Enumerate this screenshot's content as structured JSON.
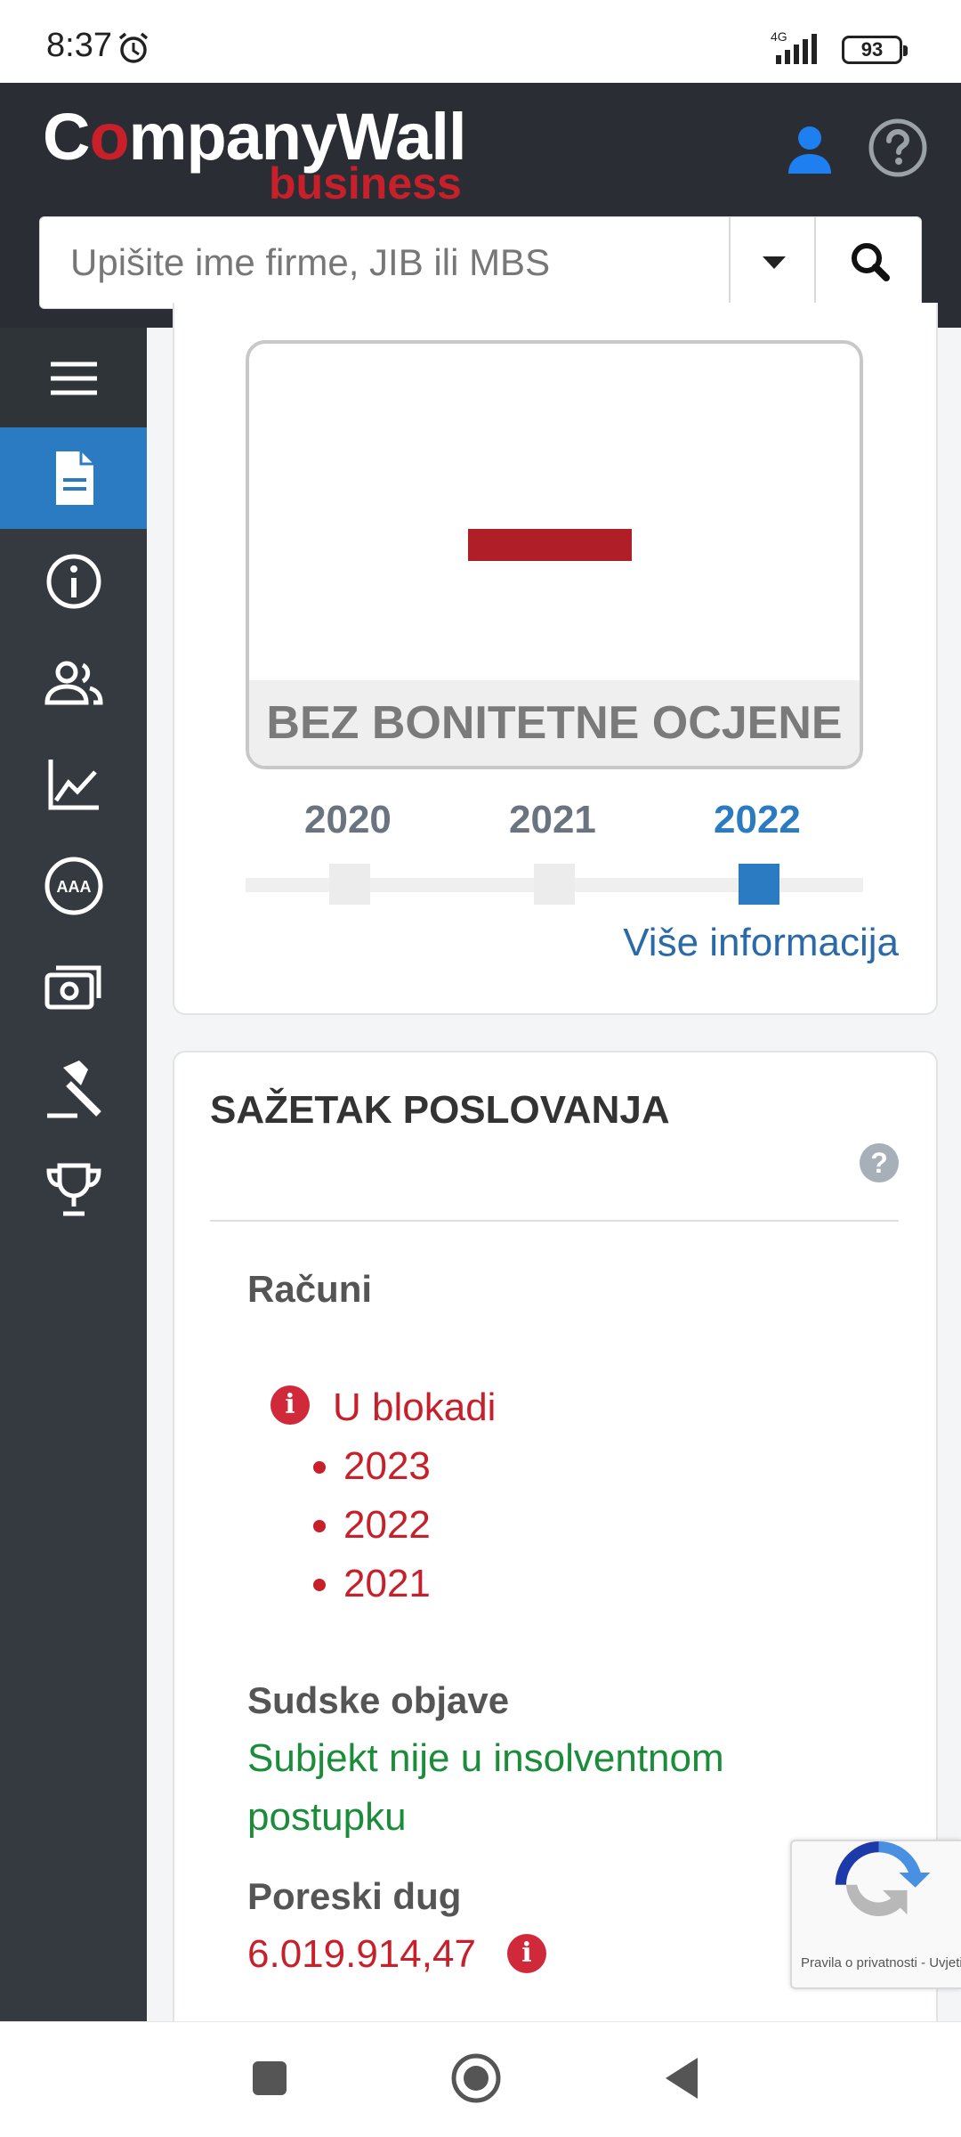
{
  "status_bar": {
    "time": "8:37",
    "network": "4G",
    "battery": "93"
  },
  "header": {
    "logo_main_pre": "C",
    "logo_main_o": "o",
    "logo_main_post": "mpanyWall",
    "logo_sub": "business",
    "search_placeholder": "Upišite ime firme, JIB ili MBS"
  },
  "sidebar": {
    "items": [
      "menu-icon",
      "document-icon",
      "info-icon",
      "users-icon",
      "chart-icon",
      "rating-icon",
      "money-icon",
      "gavel-icon",
      "trophy-icon"
    ]
  },
  "rating": {
    "value": "—",
    "label": "BEZ BONITETNE OCJENE",
    "years": [
      "2020",
      "2021",
      "2022"
    ],
    "selected_year": "2022",
    "more_link": "Više informacija"
  },
  "summary": {
    "title": "SAŽETAK POSLOVANJA",
    "help": "?",
    "accounts_label": "Računi",
    "blocked_label": "U blokadi",
    "blocked_years": [
      "2023",
      "2022",
      "2021"
    ],
    "court_label": "Sudske objave",
    "court_line1": "Subjekt nije u insolventnom",
    "court_line2": "postupku",
    "tax_label": "Poreski dug",
    "tax_value": "6.019.914,47"
  },
  "recaptcha": {
    "legal": "Pravila o privatnosti - Uvjeti"
  },
  "colors": {
    "accent": "#2a7bc2",
    "brand_red": "#c8202a",
    "header_bg": "#2a2d33",
    "sidebar_bg": "#343a40",
    "ok_green": "#1a8c3a"
  }
}
